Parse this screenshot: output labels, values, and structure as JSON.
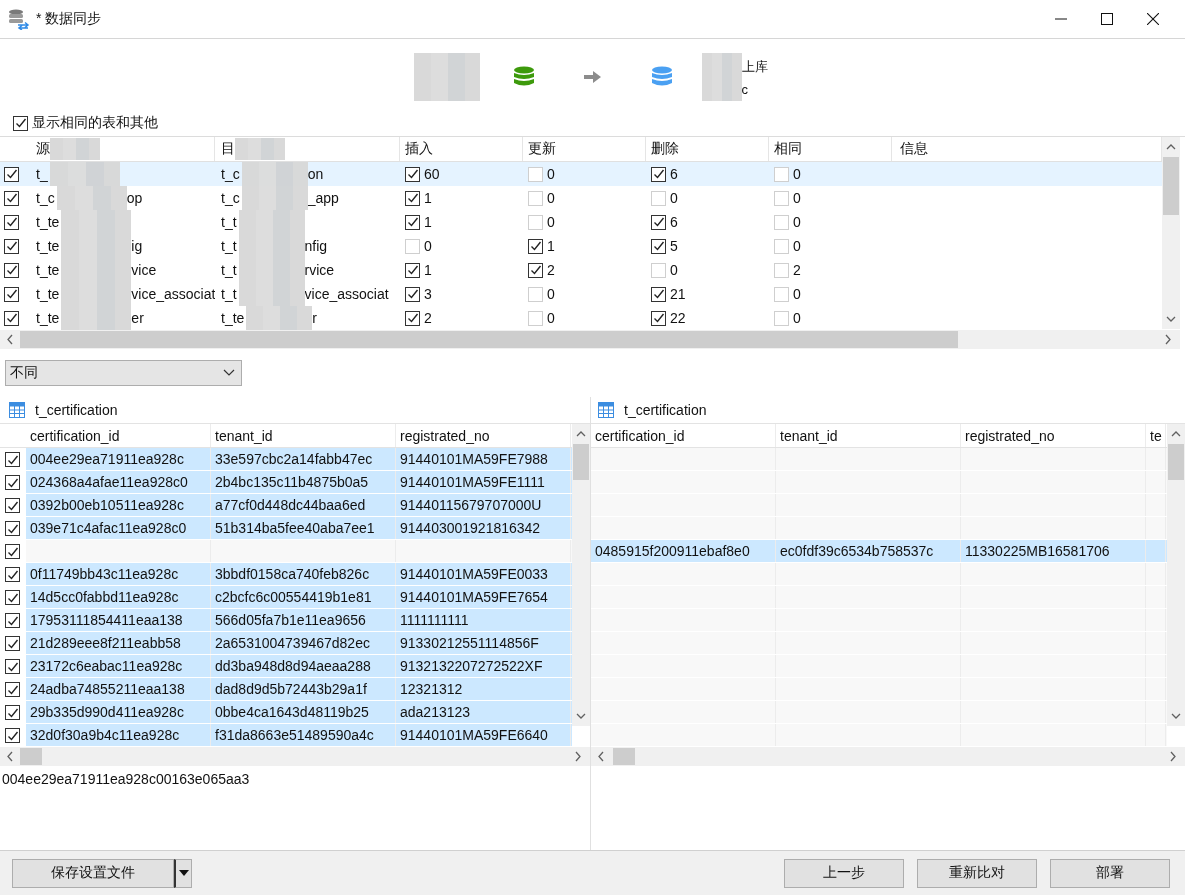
{
  "window": {
    "title": "* 数据同步"
  },
  "connection": {
    "target_lines": [
      "上库",
      "c"
    ]
  },
  "show_same": {
    "label": "显示相同的表和其他",
    "checked": true
  },
  "compare_table": {
    "columns": [
      {
        "label": "源",
        "kind": "masked"
      },
      {
        "label": "目",
        "kind": "masked"
      },
      {
        "label": "插入",
        "kind": "plain"
      },
      {
        "label": "更新",
        "kind": "plain"
      },
      {
        "label": "删除",
        "kind": "plain"
      },
      {
        "label": "相同",
        "kind": "plain"
      },
      {
        "label": "信息",
        "kind": "plain"
      }
    ],
    "rows": [
      {
        "selected": true,
        "checked": true,
        "source": [
          "t_"
        ],
        "target": [
          "t_c",
          "on"
        ],
        "insert": {
          "checked": true,
          "count": "60"
        },
        "update": {
          "checked": false,
          "count": "0"
        },
        "delete": {
          "checked": true,
          "count": "6"
        },
        "same": {
          "checked": false,
          "count": "0"
        }
      },
      {
        "selected": false,
        "checked": true,
        "source": [
          "t_c",
          "op"
        ],
        "target": [
          "t_c",
          "_app"
        ],
        "insert": {
          "checked": true,
          "count": "1"
        },
        "update": {
          "checked": false,
          "count": "0"
        },
        "delete": {
          "checked": false,
          "count": "0"
        },
        "same": {
          "checked": false,
          "count": "0"
        }
      },
      {
        "selected": false,
        "checked": true,
        "source": [
          "t_te"
        ],
        "target": [
          "t_t"
        ],
        "insert": {
          "checked": true,
          "count": "1"
        },
        "update": {
          "checked": false,
          "count": "0"
        },
        "delete": {
          "checked": true,
          "count": "6"
        },
        "same": {
          "checked": false,
          "count": "0"
        }
      },
      {
        "selected": false,
        "checked": true,
        "source": [
          "t_te",
          "ig"
        ],
        "target": [
          "t_t",
          "nfig"
        ],
        "insert": {
          "checked": false,
          "count": "0"
        },
        "update": {
          "checked": true,
          "count": "1"
        },
        "delete": {
          "checked": true,
          "count": "5"
        },
        "same": {
          "checked": false,
          "count": "0"
        }
      },
      {
        "selected": false,
        "checked": true,
        "source": [
          "t_te",
          "vice"
        ],
        "target": [
          "t_t",
          "rvice"
        ],
        "insert": {
          "checked": true,
          "count": "1"
        },
        "update": {
          "checked": true,
          "count": "2"
        },
        "delete": {
          "checked": false,
          "count": "0"
        },
        "same": {
          "checked": false,
          "count": "2"
        }
      },
      {
        "selected": false,
        "checked": true,
        "source": [
          "t_te",
          "vice_associat"
        ],
        "target": [
          "t_t",
          "vice_associat"
        ],
        "insert": {
          "checked": true,
          "count": "3"
        },
        "update": {
          "checked": false,
          "count": "0"
        },
        "delete": {
          "checked": true,
          "count": "21"
        },
        "same": {
          "checked": false,
          "count": "0"
        }
      },
      {
        "selected": false,
        "checked": true,
        "source": [
          "t_te",
          "er"
        ],
        "target": [
          "t_te",
          "r"
        ],
        "insert": {
          "checked": true,
          "count": "2"
        },
        "update": {
          "checked": false,
          "count": "0"
        },
        "delete": {
          "checked": true,
          "count": "22"
        },
        "same": {
          "checked": false,
          "count": "0"
        }
      }
    ]
  },
  "filter": {
    "value": "不同"
  },
  "source_grid": {
    "title": "t_certification",
    "columns": [
      "certification_id",
      "tenant_id",
      "registrated_no"
    ],
    "rows": [
      {
        "checked": true,
        "selected": true,
        "cells": [
          "004ee29ea71911ea928c",
          "33e597cbc2a14fabb47ec",
          "91440101MA59FE7988"
        ]
      },
      {
        "checked": true,
        "selected": true,
        "cells": [
          "024368a4afae11ea928c0",
          "2b4bc135c11b4875b0a5",
          "91440101MA59FE1111"
        ]
      },
      {
        "checked": true,
        "selected": true,
        "cells": [
          "0392b00eb10511ea928c",
          "a77cf0d448dc44baa6ed",
          "91440115679707000U"
        ]
      },
      {
        "checked": true,
        "selected": true,
        "cells": [
          "039e71c4afac11ea928c0",
          "51b314ba5fee40aba7ee1",
          "914403001921816342"
        ]
      },
      {
        "checked": true,
        "selected": false,
        "cells": []
      },
      {
        "checked": true,
        "selected": true,
        "cells": [
          "0f11749bb43c11ea928c",
          "3bbdf0158ca740feb826c",
          "91440101MA59FE0033"
        ]
      },
      {
        "checked": true,
        "selected": true,
        "cells": [
          "14d5cc0fabbd11ea928c",
          "c2bcfc6c00554419b1e81",
          "91440101MA59FE7654"
        ]
      },
      {
        "checked": true,
        "selected": true,
        "cells": [
          "17953111854411eaa138",
          "566d05fa7b1e11ea9656",
          "1111111111"
        ]
      },
      {
        "checked": true,
        "selected": true,
        "cells": [
          "21d289eee8f211eabb58",
          "2a6531004739467d82ec",
          "91330212551114856F"
        ]
      },
      {
        "checked": true,
        "selected": true,
        "cells": [
          "23172c6eabac11ea928c",
          "dd3ba948d8d94aeaa288",
          "9132132207272522XF"
        ]
      },
      {
        "checked": true,
        "selected": true,
        "cells": [
          "24adba74855211eaa138",
          "dad8d9d5b72443b29a1f",
          "12321312"
        ]
      },
      {
        "checked": true,
        "selected": true,
        "cells": [
          "29b335d990d411ea928c",
          "0bbe4ca1643d48119b25",
          "ada213123"
        ]
      },
      {
        "checked": true,
        "selected": true,
        "cells": [
          "32d0f30a9b4c11ea928c",
          "f31da8663e51489590a4c",
          "91440101MA59FE6640"
        ]
      }
    ]
  },
  "target_grid": {
    "title": "t_certification",
    "columns": [
      "certification_id",
      "tenant_id",
      "registrated_no",
      "te"
    ],
    "rows": [
      {
        "selected": false,
        "cells": []
      },
      {
        "selected": false,
        "cells": []
      },
      {
        "selected": false,
        "cells": []
      },
      {
        "selected": false,
        "cells": []
      },
      {
        "selected": true,
        "cells": [
          "0485915f200911ebaf8e0",
          "ec0fdf39c6534b758537c",
          "11330225MB16581706"
        ]
      },
      {
        "selected": false,
        "cells": []
      },
      {
        "selected": false,
        "cells": []
      },
      {
        "selected": false,
        "cells": []
      },
      {
        "selected": false,
        "cells": []
      },
      {
        "selected": false,
        "cells": []
      },
      {
        "selected": false,
        "cells": []
      },
      {
        "selected": false,
        "cells": []
      },
      {
        "selected": false,
        "cells": []
      }
    ]
  },
  "detail_value": "004ee29ea71911ea928c00163e065aa3",
  "footer": {
    "save_button": "保存设置文件",
    "buttons": [
      "上一步",
      "重新比对",
      "部署"
    ]
  }
}
